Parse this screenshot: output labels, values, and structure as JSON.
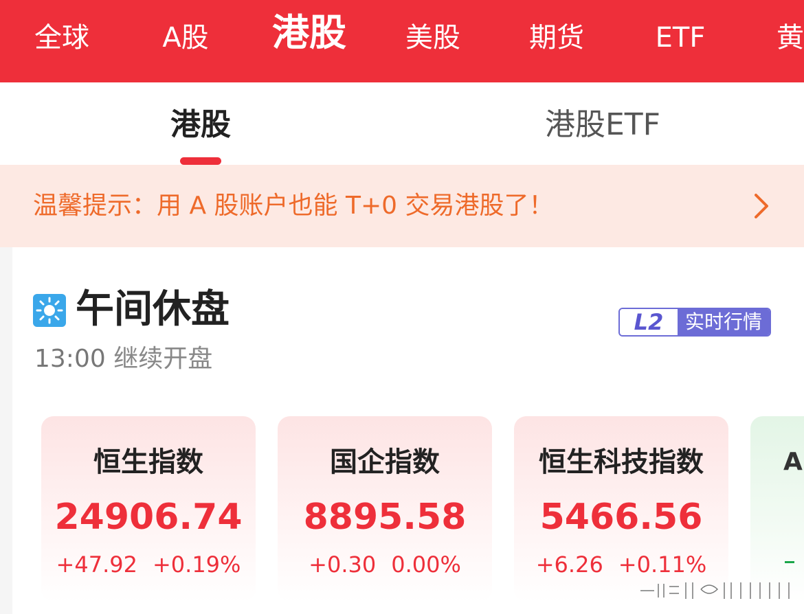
{
  "top_tabs": [
    "全球",
    "A股",
    "港股",
    "美股",
    "期货",
    "ETF",
    "黄"
  ],
  "active_top_tab": "港股",
  "sub_tabs": [
    "港股",
    "港股ETF"
  ],
  "active_sub_tab": "港股",
  "notice": {
    "text": "温馨提示：用 A 股账户也能 T+0 交易港股了！"
  },
  "market_status": {
    "title": "午间休盘",
    "reopen_time": "13:00",
    "reopen_label": "继续开盘"
  },
  "badge": {
    "level": "L2",
    "label": "实时行情"
  },
  "indices": [
    {
      "name": "恒生指数",
      "value": "24906.74",
      "change": "+47.92",
      "change_pct": "+0.19%"
    },
    {
      "name": "国企指数",
      "value": "8895.58",
      "change": "+0.30",
      "change_pct": "0.00%"
    },
    {
      "name": "恒生科技指数",
      "value": "5466.56",
      "change": "+6.26",
      "change_pct": "+0.11%"
    }
  ],
  "partial_card": {
    "initial": "A"
  },
  "colors": {
    "brand_red": "#ee2f3a",
    "notice_orange": "#ee6a2a",
    "l2_purple": "#6c6cd6",
    "down_green": "#1aa64a"
  },
  "icons": {
    "sun": "sun-icon",
    "notice_arrow": "chevron-right-icon"
  }
}
